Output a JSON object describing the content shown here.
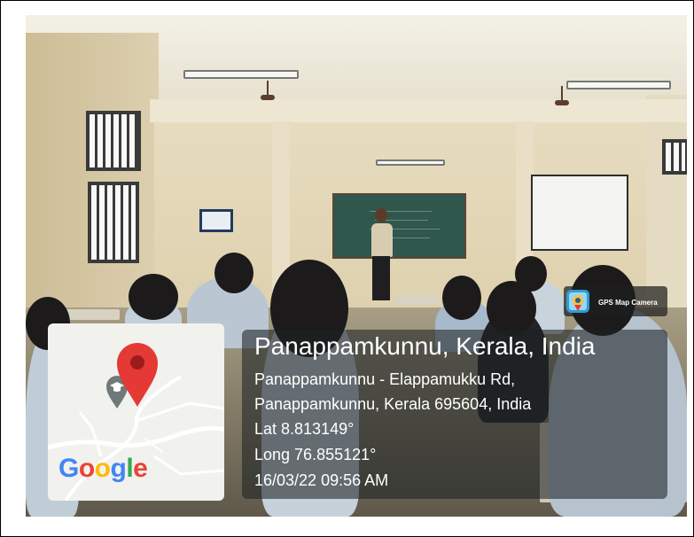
{
  "overlay": {
    "badge_label": "GPS Map Camera",
    "location_title": "Panappamkunnu, Kerala, India",
    "address_line1": "Panappamkunnu - Elappamukku Rd,",
    "address_line2": "Panappamkunnu, Kerala 695604, India",
    "latitude": "Lat 8.813149°",
    "longitude": "Long 76.855121°",
    "timestamp": "16/03/22 09:56 AM"
  },
  "map": {
    "logo_letters": [
      "G",
      "o",
      "o",
      "g",
      "l",
      "e"
    ],
    "logo_colors": [
      "#4285F4",
      "#EA4335",
      "#FBBC05",
      "#4285F4",
      "#34A853",
      "#EA4335"
    ],
    "pin_color": "#E53935",
    "pin_icon": "map-pin-icon",
    "poi_icon": "school-cap-icon"
  },
  "badge": {
    "icon": "gps-map-camera-app-icon",
    "icon_color": "#2E9CDB"
  }
}
